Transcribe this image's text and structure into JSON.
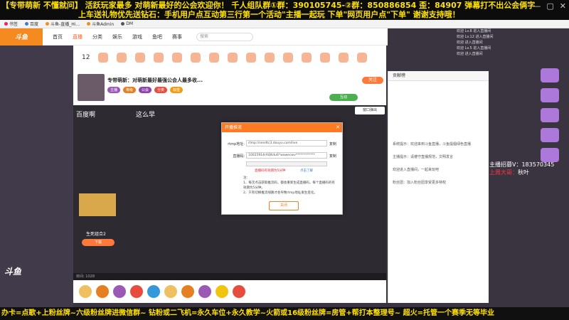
{
  "top_banner": {
    "line1": "【专带萌新 不懂就问】 活跃玩家最多 对萌新最好的公会欢迎你！ 千人组队群①群：390105745-②群：850886854 歪：84907 弹幕打不出公会俩字",
    "line2": "上车送礼物优先送钻石：手机用户点互动第三行第一个活动\"主播一起玩 下单\"网页用户点\"下单\" 谢谢支持哦！"
  },
  "window_controls": [
    "—",
    "▢",
    "✕"
  ],
  "bookmarks": [
    "书签",
    "百度",
    "斗鱼-直播_Hi...",
    "斗鱼Admin",
    "DM"
  ],
  "site_nav": {
    "logo": "斗鱼",
    "items": [
      "首页",
      "直播",
      "分类",
      "娱乐",
      "游戏",
      "鱼吧",
      "赛事"
    ],
    "active_index": 1,
    "search_placeholder": "搜索"
  },
  "toolbar": {
    "count": "12"
  },
  "header": {
    "room_title": "专带萌新：对萌新最好最强公会人最多收...",
    "tags": [
      "主播",
      "等级",
      "公会",
      "分类",
      "标签"
    ],
    "follow": "关注",
    "green_button": "互动"
  },
  "player": {
    "text_left": "百度啊",
    "text_mid": "这么早",
    "popout": "窗口弹出",
    "anchor_name": "生死组合2",
    "anchor_button": "下载",
    "playbar_text": "房间: 1028"
  },
  "chat": {
    "head": "贡献榜",
    "lines": [
      "系统提示：欢迎来到斗鱼直播，斗鱼提倡绿色直播",
      "主播提示：请遵守直播规范，文明发言",
      "欢迎进入直播间，一起来玩吧",
      "粉丝团：加入粉丝团享受更多特权"
    ]
  },
  "join_lines": [
    "欢迎 Lv.8 进入直播间",
    "欢迎 Lv.12 进入直播间",
    "欢迎 进入直播间",
    "欢迎 Lv.5 进入直播间",
    "欢迎 进入直播间"
  ],
  "recruit": {
    "line1": "主播招募V：183570345",
    "line2_red": "上周大哥：",
    "line2_white": "秋叶"
  },
  "bottom_banner": "办卡=点歌+上粉丝牌~六级粉丝牌进微信群~ 钻粉或二飞机=永久车位+永久教学~火箭或16级粉丝牌=房管+帮打本整理号~ 超火=托管一个赛季无等毕业",
  "modal": {
    "title": "开播推流",
    "close": "✕",
    "rtmp_label": "rtmp地址:",
    "rtmp_value": "rtmp://sendtc3.douyu.com/live",
    "key_label": "直播码:",
    "key_value": "10025914rAQKdu6*wawecwv************",
    "copy": "复制",
    "warning": "直播码有效期为5分钟",
    "help": "点击了解",
    "notes": [
      "注：",
      "1、每次点击获取推流码，都会重新生成直播码，每个直播码的有效期为5分钟。",
      "2、只有切换推流线路才会导致rtmp地址发生变化。"
    ],
    "close_button": "关闭"
  }
}
